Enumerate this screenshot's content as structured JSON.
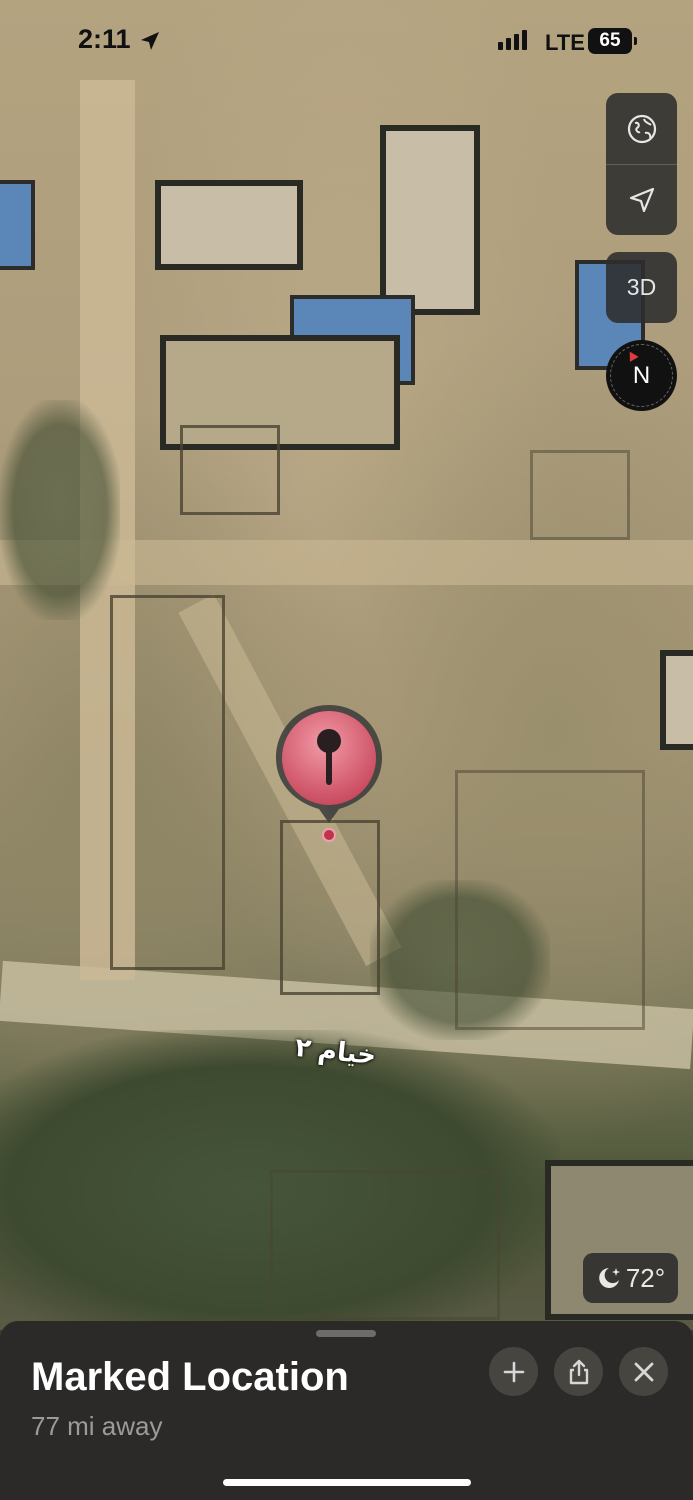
{
  "status_bar": {
    "time": "2:11",
    "network": "LTE",
    "battery": "65"
  },
  "map": {
    "road_label": "خیام ۲",
    "controls": {
      "map_mode_icon": "globe-icon",
      "locate_icon": "location-arrow-icon",
      "three_d_label": "3D",
      "compass_label": "N"
    },
    "weather": {
      "icon": "moon-stars-icon",
      "temperature": "72°"
    },
    "pin_icon": "marked-location-pin-icon"
  },
  "place_sheet": {
    "title": "Marked Location",
    "subtitle": "77 mi away",
    "actions": {
      "add_icon": "plus-icon",
      "share_icon": "share-icon",
      "close_icon": "close-icon"
    }
  },
  "colors": {
    "pin": "#d8586c",
    "sheet_background": "#2b2a28",
    "control_background": "#2d2d2d"
  }
}
